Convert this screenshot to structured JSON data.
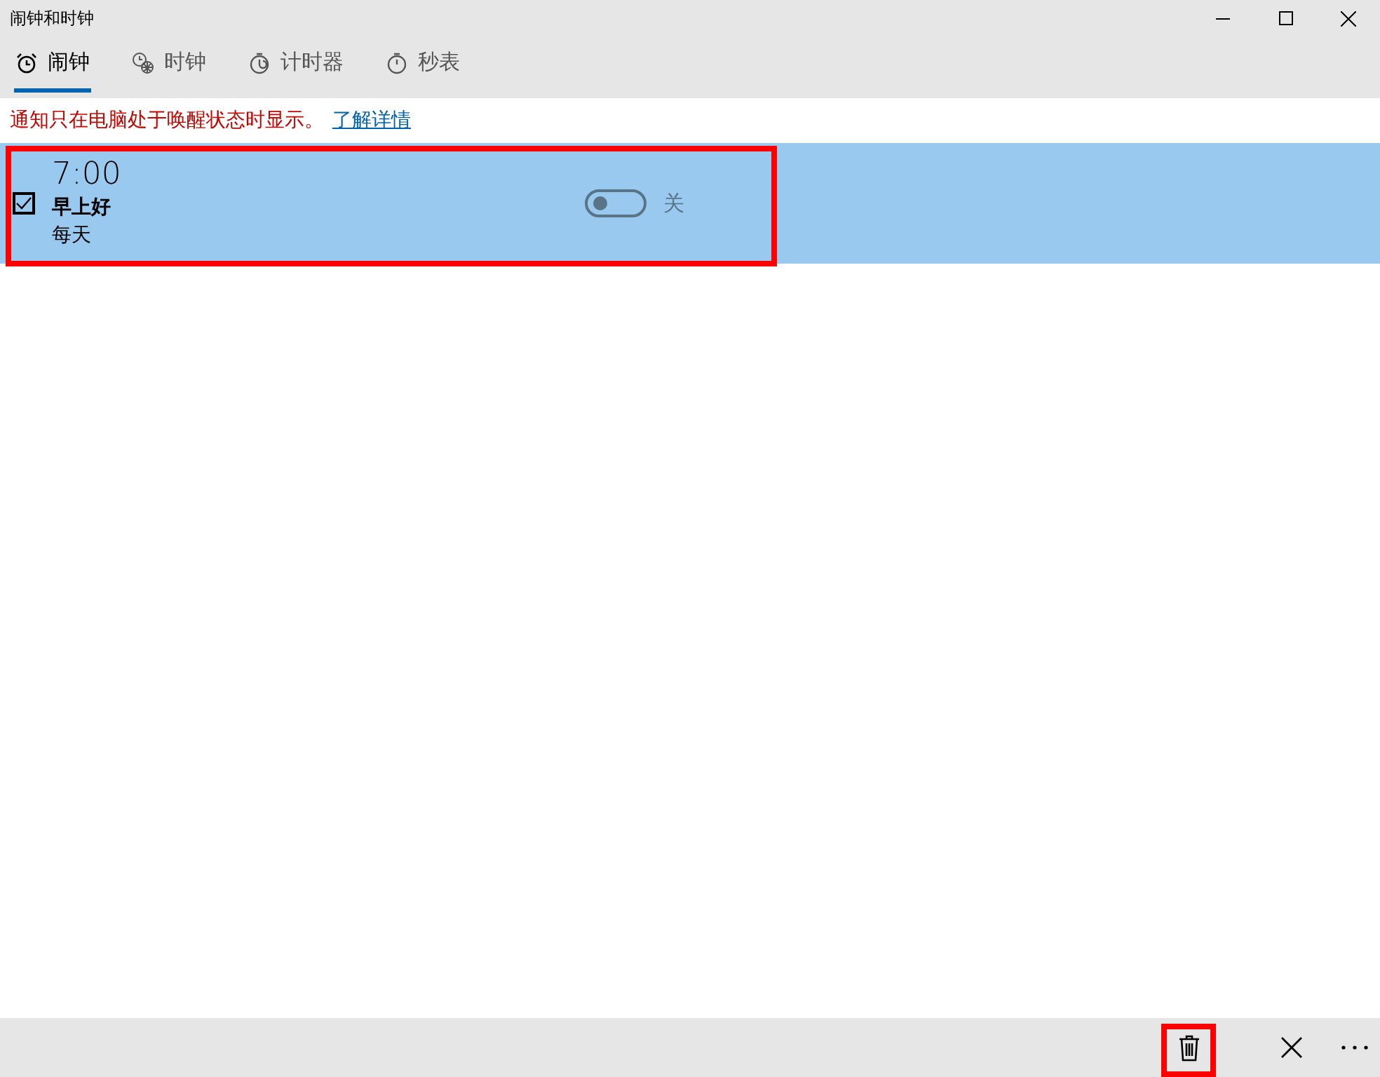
{
  "window": {
    "title": "闹钟和时钟"
  },
  "tabs": [
    {
      "label": "闹钟",
      "selected": true
    },
    {
      "label": "时钟",
      "selected": false
    },
    {
      "label": "计时器",
      "selected": false
    },
    {
      "label": "秒表",
      "selected": false
    }
  ],
  "notice": {
    "text": "通知只在电脑处于唤醒状态时显示。",
    "link": "了解详情"
  },
  "alarms": [
    {
      "time": "7:00",
      "name": "早上好",
      "repeat": "每天",
      "checked": true,
      "selected": true,
      "on": false,
      "state_label": "关",
      "highlighted": true
    }
  ],
  "commands": [
    {
      "kind": "delete",
      "highlighted": true
    },
    {
      "kind": "cancel",
      "highlighted": false
    },
    {
      "kind": "more",
      "highlighted": false
    }
  ]
}
